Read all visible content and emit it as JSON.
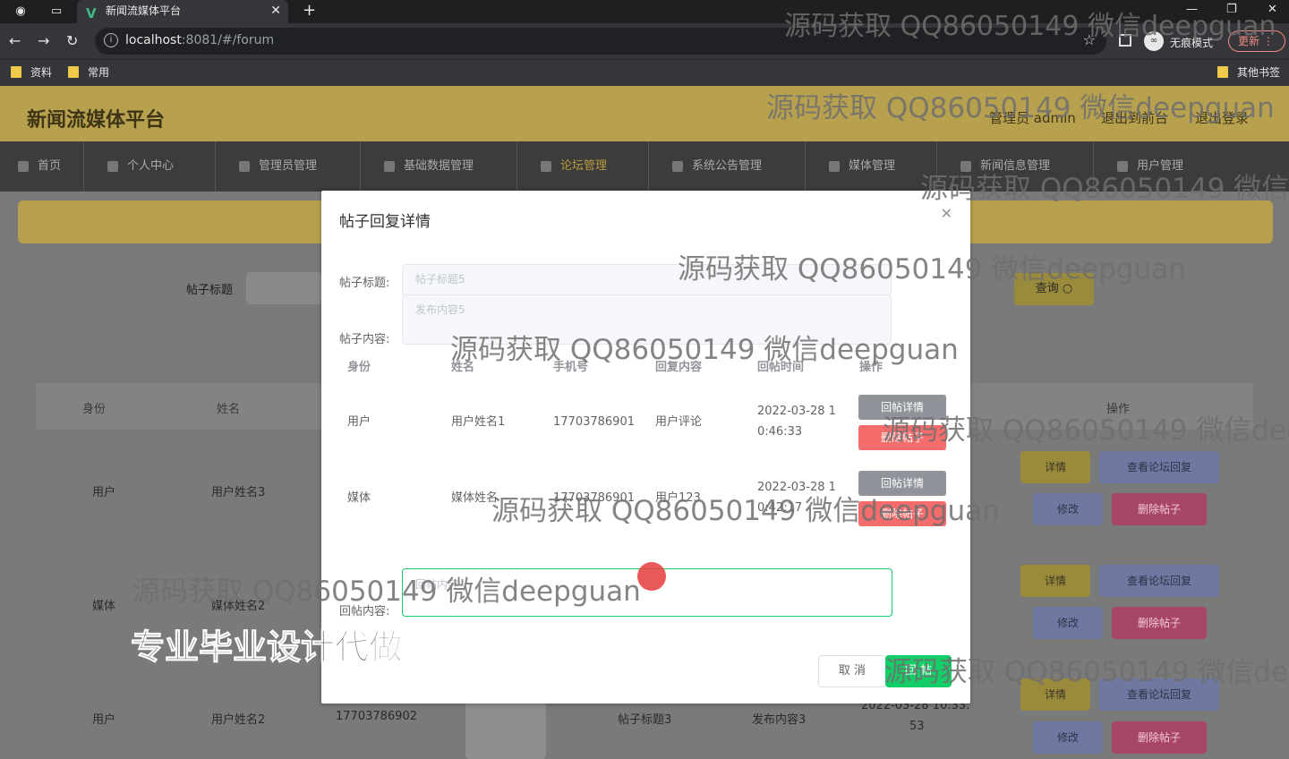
{
  "browser": {
    "tab_title": "新闻流媒体平台",
    "url_host": "localhost",
    "url_rest": ":8081/#/forum",
    "incognito_label": "无痕模式",
    "update_label": "更新",
    "bookmarks": [
      "资料",
      "常用"
    ],
    "other_bookmarks": "其他书签"
  },
  "app": {
    "title": "新闻流媒体平台",
    "user_label": "管理员 admin",
    "back_to_front": "退出到前台",
    "logout": "退出登录",
    "nav": [
      "首页",
      "个人中心",
      "管理员管理",
      "基础数据管理",
      "论坛管理",
      "系统公告管理",
      "媒体管理",
      "新闻信息管理",
      "用户管理"
    ]
  },
  "list": {
    "search_label": "帖子标题",
    "query_button": "查询",
    "headers": [
      "身份",
      "姓名",
      "操作"
    ],
    "rows": [
      {
        "identity": "用户",
        "name": "用户姓名3"
      },
      {
        "identity": "媒体",
        "name": "媒体姓名2"
      },
      {
        "identity": "用户",
        "name": "用户姓名2",
        "phone": "17703786902",
        "title": "帖子标题3",
        "content": "发布内容3",
        "time_line1": "2022-03-28 10:33:",
        "time_line2": "53"
      }
    ],
    "btn_detail": "详情",
    "btn_view_replies": "查看论坛回复",
    "btn_edit": "修改",
    "btn_delete": "删除帖子"
  },
  "modal": {
    "title": "帖子回复详情",
    "label_title": "帖子标题:",
    "value_title": "帖子标题5",
    "label_content": "帖子内容:",
    "value_content": "发布内容5",
    "reply_headers": [
      "身份",
      "姓名",
      "手机号",
      "回复内容",
      "回帖时间",
      "操作"
    ],
    "replies": [
      {
        "identity": "用户",
        "name": "用户姓名1",
        "phone": "17703786901",
        "content": "用户评论",
        "time_line1": "2022-03-28 1",
        "time_line2": "0:46:33"
      },
      {
        "identity": "媒体",
        "name": "媒体姓名",
        "phone": "17703786901",
        "content": "用户123",
        "time_line1": "2022-03-28 1",
        "time_line2": "0:42:17"
      }
    ],
    "btn_reply_detail": "回帖详情",
    "btn_delete_post": "删除帖子",
    "label_reply": "回帖内容:",
    "reply_placeholder": "回帖内容",
    "cancel": "取 消",
    "submit": "回 帖"
  },
  "watermark": {
    "text": "源码获取 QQ86050149 微信deepguan",
    "banner": "专业毕业设计代做"
  },
  "colors": {
    "header": "#b8a14e",
    "nav_bg": "#3c3c3c",
    "submit": "#13ce66",
    "danger": "#f56c6c"
  }
}
